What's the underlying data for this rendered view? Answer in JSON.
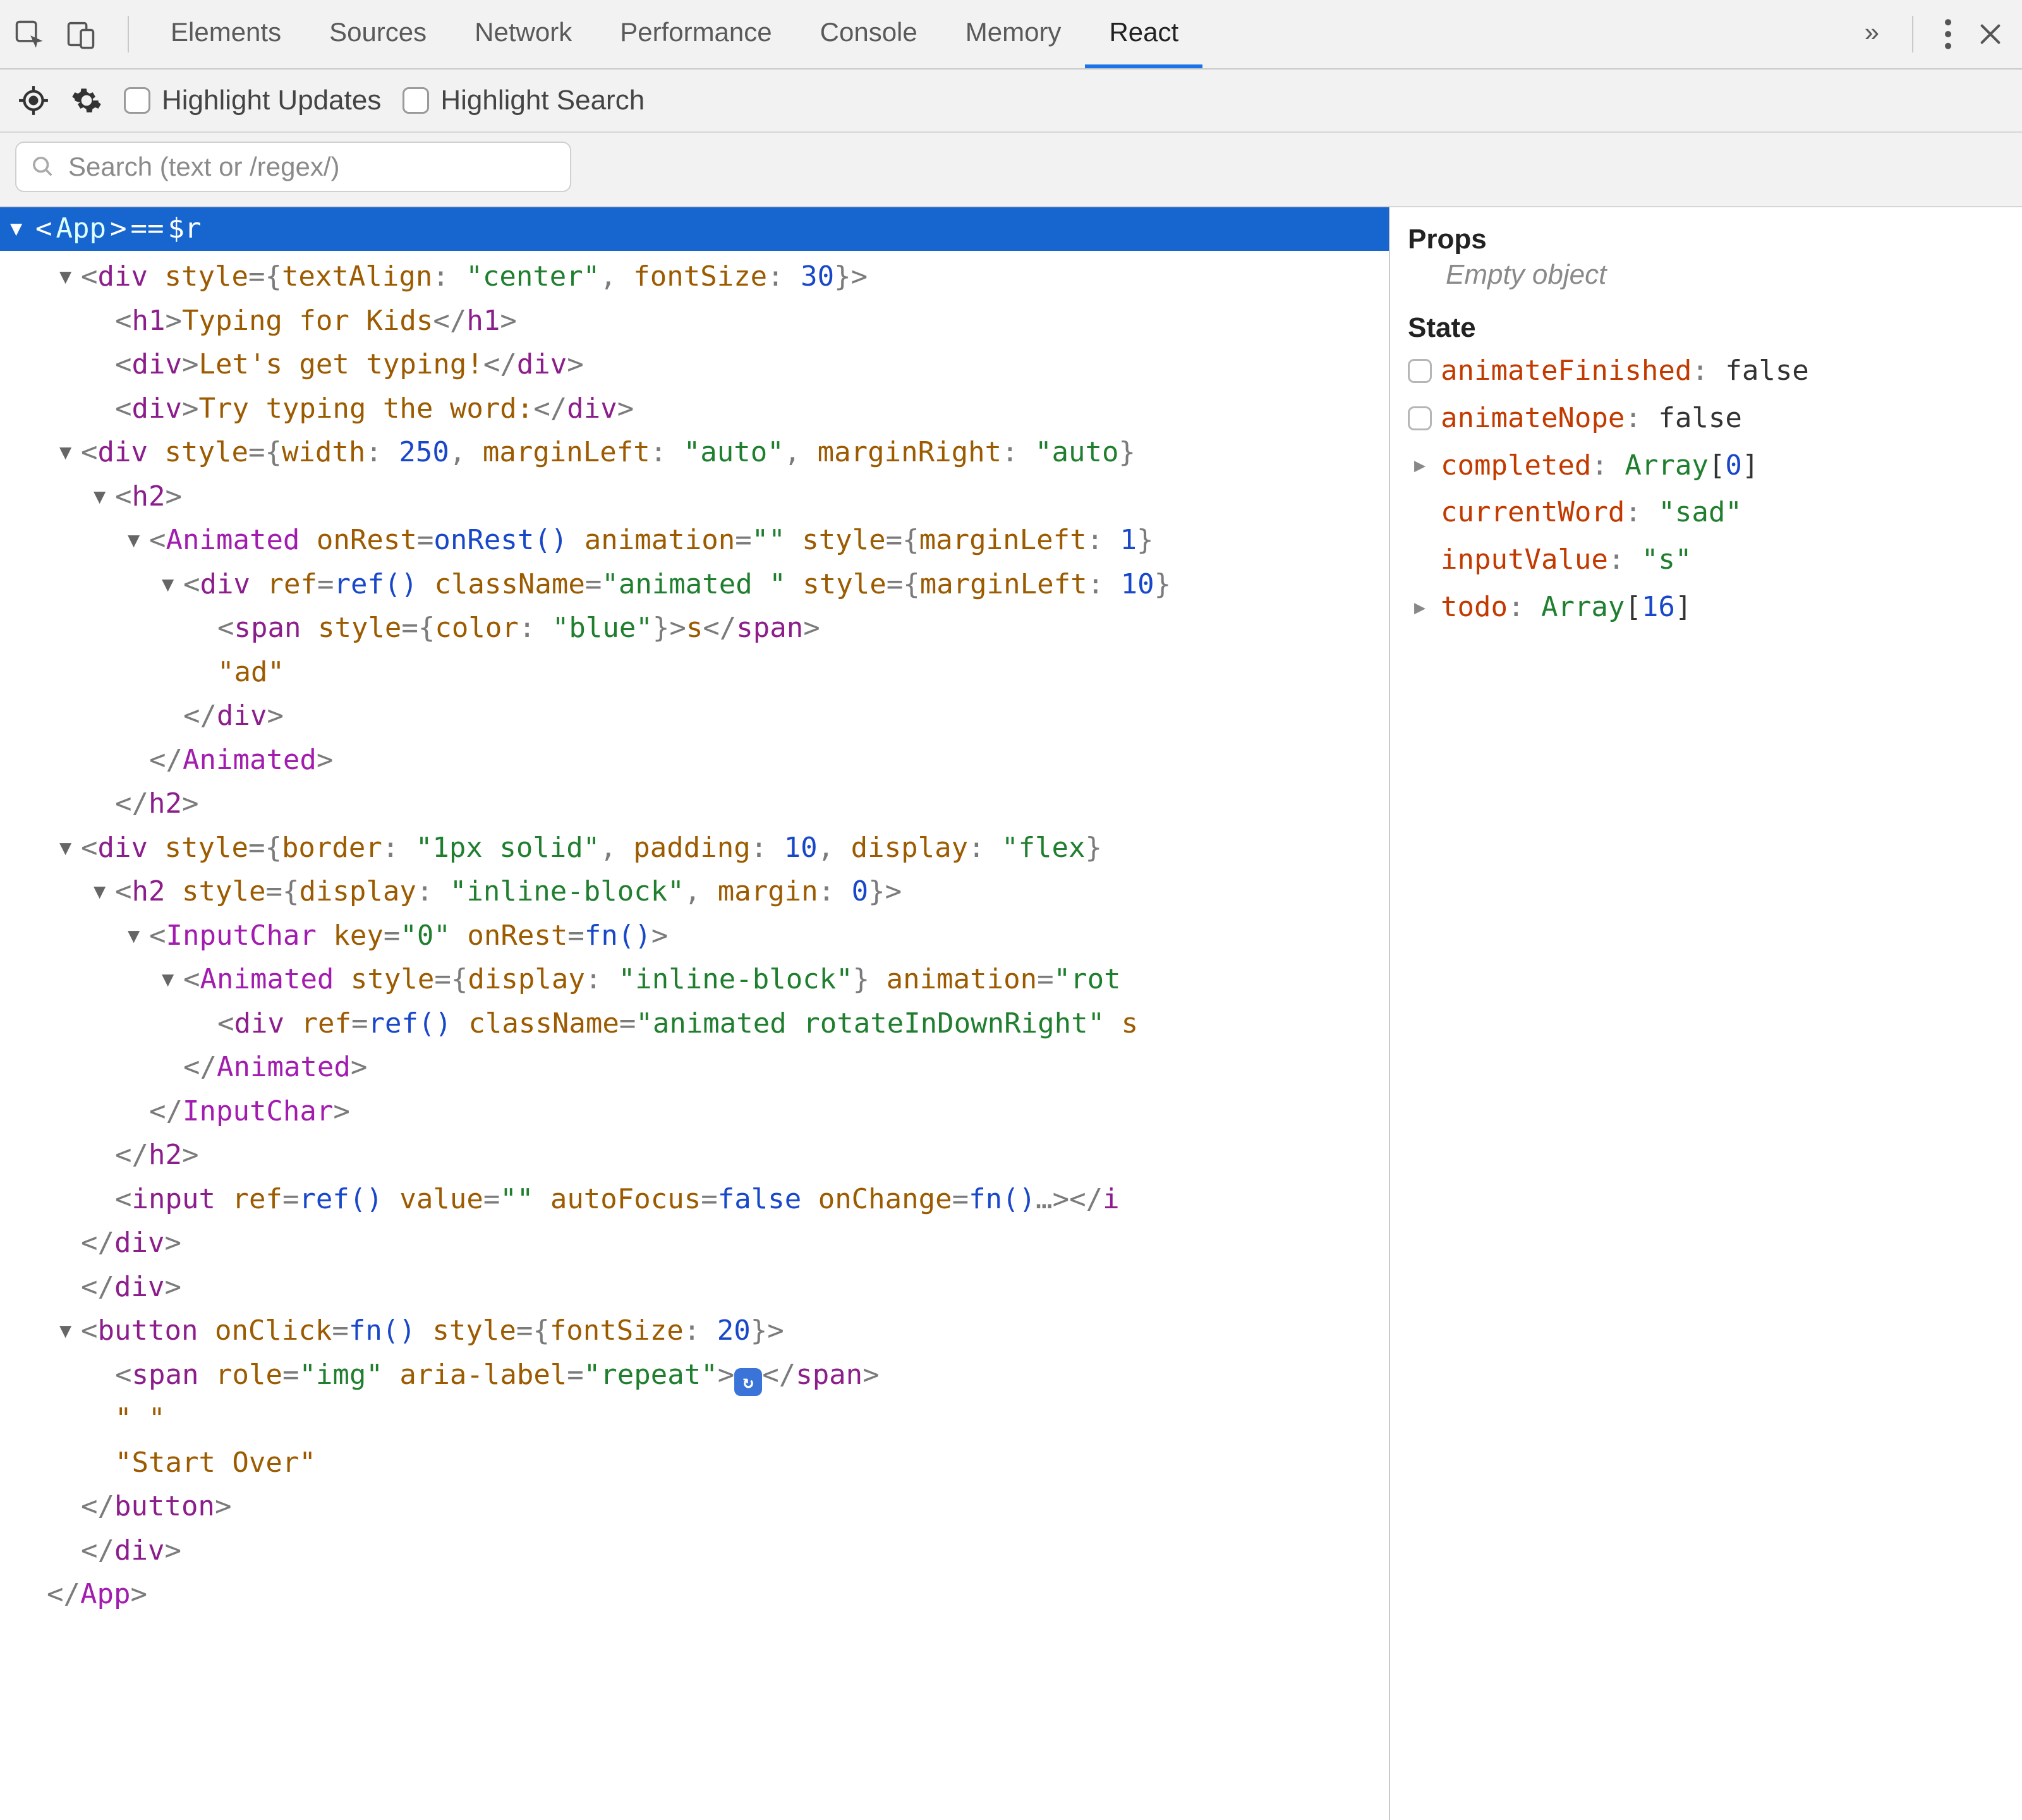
{
  "tabs": {
    "items": [
      "Elements",
      "Sources",
      "Network",
      "Performance",
      "Console",
      "Memory",
      "React"
    ],
    "activeIndex": 6,
    "overflowGlyph": "»"
  },
  "toolbar": {
    "highlightUpdates": "Highlight Updates",
    "highlightSearch": "Highlight Search"
  },
  "search": {
    "placeholder": "Search (text or /regex/)"
  },
  "selectedRoot": {
    "open": "<",
    "name": "App",
    "close": ">",
    "equals": " == ",
    "var": "$r"
  },
  "tree": [
    {
      "d": 1,
      "t": "open",
      "kind": "tag",
      "name": "div",
      "attrs": [
        {
          "n": "style",
          "obj": [
            [
              "textAlign",
              "\"center\""
            ],
            [
              "fontSize",
              "30"
            ]
          ]
        }
      ]
    },
    {
      "d": 2,
      "t": "inline",
      "kind": "tag",
      "name": "h1",
      "text": "Typing for Kids"
    },
    {
      "d": 2,
      "t": "inline",
      "kind": "tag",
      "name": "div",
      "text": "Let's get typing!"
    },
    {
      "d": 2,
      "t": "inline",
      "kind": "tag",
      "name": "div",
      "text": "Try typing the word:"
    },
    {
      "d": 1,
      "t": "open",
      "kind": "tag",
      "name": "div",
      "attrs": [
        {
          "n": "style",
          "obj": [
            [
              "width",
              "250"
            ],
            [
              "marginLeft",
              "\"auto\""
            ],
            [
              "marginRight",
              "\"auto"
            ]
          ]
        }
      ],
      "clip": true
    },
    {
      "d": 2,
      "t": "open",
      "kind": "tag",
      "name": "h2"
    },
    {
      "d": 3,
      "t": "open",
      "kind": "comp",
      "name": "Animated",
      "attrs": [
        {
          "n": "onRest",
          "fn": "onRest()"
        },
        {
          "n": "animation",
          "str": "\"\""
        },
        {
          "n": "style",
          "obj": [
            [
              "marginLeft",
              "1"
            ]
          ]
        }
      ],
      "clip": true
    },
    {
      "d": 4,
      "t": "open",
      "kind": "tag",
      "name": "div",
      "attrs": [
        {
          "n": "ref",
          "fn": "ref()"
        },
        {
          "n": "className",
          "str": "\"animated \""
        },
        {
          "n": "style",
          "obj": [
            [
              "marginLeft",
              "10"
            ]
          ]
        }
      ],
      "clip": true
    },
    {
      "d": 5,
      "t": "inline",
      "kind": "tag",
      "name": "span",
      "attrs": [
        {
          "n": "style",
          "obj": [
            [
              "color",
              "\"blue\""
            ]
          ]
        }
      ],
      "text": "s"
    },
    {
      "d": 5,
      "t": "text",
      "text": "\"ad\""
    },
    {
      "d": 4,
      "t": "close",
      "kind": "tag",
      "name": "div"
    },
    {
      "d": 3,
      "t": "close",
      "kind": "comp",
      "name": "Animated"
    },
    {
      "d": 2,
      "t": "close",
      "kind": "tag",
      "name": "h2"
    },
    {
      "d": 1,
      "t": "open",
      "kind": "tag",
      "name": "div",
      "attrs": [
        {
          "n": "style",
          "obj": [
            [
              "border",
              "\"1px solid\""
            ],
            [
              "padding",
              "10"
            ],
            [
              "display",
              "\"flex"
            ]
          ]
        }
      ],
      "clip": true
    },
    {
      "d": 2,
      "t": "open",
      "kind": "tag",
      "name": "h2",
      "attrs": [
        {
          "n": "style",
          "obj": [
            [
              "display",
              "\"inline-block\""
            ],
            [
              "margin",
              "0"
            ]
          ]
        }
      ]
    },
    {
      "d": 3,
      "t": "open",
      "kind": "comp",
      "name": "InputChar",
      "attrs": [
        {
          "n": "key",
          "str": "\"0\""
        },
        {
          "n": "onRest",
          "fn": "fn()"
        }
      ]
    },
    {
      "d": 4,
      "t": "open",
      "kind": "comp",
      "name": "Animated",
      "attrs": [
        {
          "n": "style",
          "obj": [
            [
              "display",
              "\"inline-block\""
            ]
          ]
        },
        {
          "n": "animation",
          "str": "\"rot"
        }
      ],
      "clip": true
    },
    {
      "d": 5,
      "t": "selfline",
      "kind": "tag",
      "name": "div",
      "attrs": [
        {
          "n": "ref",
          "fn": "ref()"
        },
        {
          "n": "className",
          "str": "\"animated rotateInDownRight\""
        }
      ],
      "trail": " s",
      "clip": true
    },
    {
      "d": 4,
      "t": "close",
      "kind": "comp",
      "name": "Animated"
    },
    {
      "d": 3,
      "t": "close",
      "kind": "comp",
      "name": "InputChar"
    },
    {
      "d": 2,
      "t": "close",
      "kind": "tag",
      "name": "h2"
    },
    {
      "d": 2,
      "t": "selfclose",
      "kind": "tag",
      "name": "input",
      "attrs": [
        {
          "n": "ref",
          "fn": "ref()"
        },
        {
          "n": "value",
          "str": "\"\""
        },
        {
          "n": "autoFocus",
          "bool": "false"
        },
        {
          "n": "onChange",
          "fn": "fn()"
        }
      ],
      "ell": true,
      "closeinline": "i"
    },
    {
      "d": 1,
      "t": "close",
      "kind": "tag",
      "name": "div"
    },
    {
      "d": 1,
      "t": "close",
      "kind": "tag",
      "name": "div"
    },
    {
      "d": 1,
      "t": "open",
      "kind": "tag",
      "name": "button",
      "attrs": [
        {
          "n": "onClick",
          "fn": "fn()"
        },
        {
          "n": "style",
          "obj": [
            [
              "fontSize",
              "20"
            ]
          ]
        }
      ]
    },
    {
      "d": 2,
      "t": "inline",
      "kind": "tag",
      "name": "span",
      "attrs": [
        {
          "n": "role",
          "str": "\"img\""
        },
        {
          "n": "aria-label",
          "str": "\"repeat\""
        }
      ],
      "emoji": true
    },
    {
      "d": 2,
      "t": "text",
      "text": "\" \""
    },
    {
      "d": 2,
      "t": "text",
      "text": "\"Start Over\""
    },
    {
      "d": 1,
      "t": "close",
      "kind": "tag",
      "name": "button"
    },
    {
      "d": 0,
      "t": "close",
      "kind": "tag",
      "name": "div",
      "depthOverride": 1
    },
    {
      "d": 0,
      "t": "close",
      "kind": "comp",
      "name": "App"
    }
  ],
  "side": {
    "propsHeading": "Props",
    "propsEmpty": "Empty object",
    "stateHeading": "State",
    "state": [
      {
        "lead": "box",
        "key": "animateFinished",
        "valType": "bool",
        "val": "false"
      },
      {
        "lead": "box",
        "key": "animateNope",
        "valType": "bool",
        "val": "false"
      },
      {
        "lead": "tri",
        "key": "completed",
        "valType": "arr",
        "val": "Array[0]"
      },
      {
        "lead": "none",
        "key": "currentWord",
        "valType": "str",
        "val": "\"sad\""
      },
      {
        "lead": "none",
        "key": "inputValue",
        "valType": "str",
        "val": "\"s\""
      },
      {
        "lead": "tri",
        "key": "todo",
        "valType": "arr",
        "val": "Array[16]"
      }
    ]
  }
}
